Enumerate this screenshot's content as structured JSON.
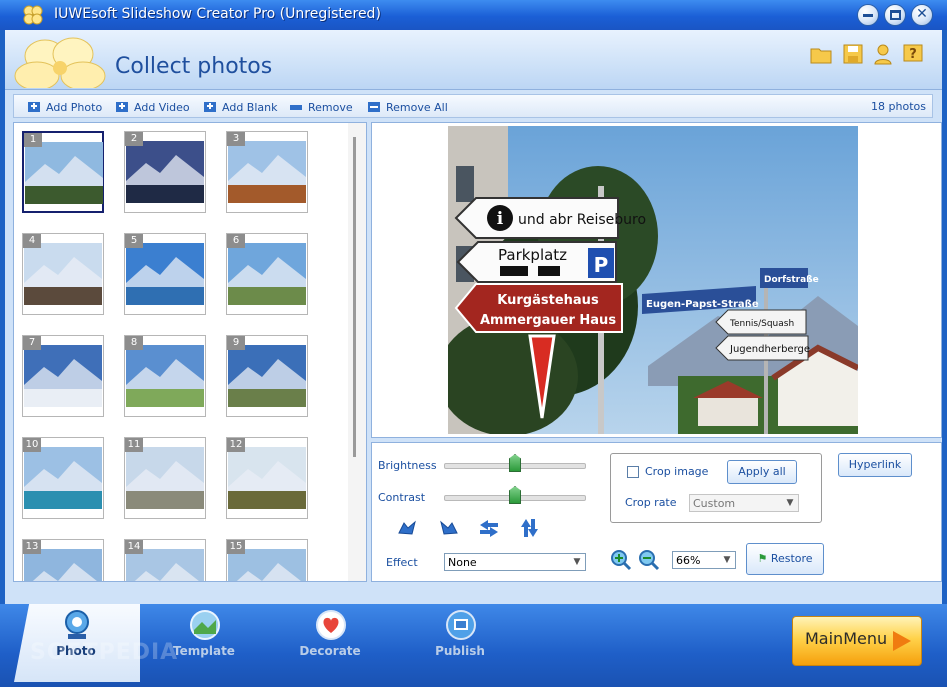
{
  "window": {
    "title": "IUWEsoft Slideshow Creator Pro (Unregistered)"
  },
  "header": {
    "title": "Collect photos"
  },
  "toolbar": {
    "add_photo": "Add Photo",
    "add_video": "Add Video",
    "add_blank": "Add Blank",
    "remove": "Remove",
    "remove_all": "Remove All",
    "photo_count": "18 photos"
  },
  "thumbnails": [
    {
      "num": "1",
      "sky": "#8fb9e0",
      "ground": "#3c5a2e"
    },
    {
      "num": "2",
      "sky": "#3c4f8a",
      "ground": "#1f2a45"
    },
    {
      "num": "3",
      "sky": "#9fc2e6",
      "ground": "#a35a2b"
    },
    {
      "num": "4",
      "sky": "#c9dbee",
      "ground": "#5b4a3c"
    },
    {
      "num": "5",
      "sky": "#3b7fd0",
      "ground": "#2f6fb2"
    },
    {
      "num": "6",
      "sky": "#6fa6dc",
      "ground": "#6c8b4a"
    },
    {
      "num": "7",
      "sky": "#3f6fb8",
      "ground": "#e9eef5"
    },
    {
      "num": "8",
      "sky": "#5a8fd0",
      "ground": "#7fa95a"
    },
    {
      "num": "9",
      "sky": "#3b6fb8",
      "ground": "#6a7f4a"
    },
    {
      "num": "10",
      "sky": "#9cc0e4",
      "ground": "#2b8fb0"
    },
    {
      "num": "11",
      "sky": "#c7d8ea",
      "ground": "#8a8a7a"
    },
    {
      "num": "12",
      "sky": "#d8e4ee",
      "ground": "#6a6a3a"
    },
    {
      "num": "13",
      "sky": "#8fb6de",
      "ground": "#4a6a3a"
    },
    {
      "num": "14",
      "sky": "#a9c6e4",
      "ground": "#6a5a4a"
    },
    {
      "num": "15",
      "sky": "#9dc0e2",
      "ground": "#7a6a5a"
    }
  ],
  "preview": {
    "sign1": "und abr Reiseburo",
    "sign2": "Parkplatz",
    "sign3a": "Kurgästehaus",
    "sign3b": "Ammergauer Haus",
    "sign4": "Eugen-Papst-Straße",
    "sign5": "Dorfstraße",
    "sign6": "Tennis/Squash",
    "sign7": "Jugendherberge",
    "parking_letter": "P",
    "info_letter": "i"
  },
  "controls": {
    "brightness_label": "Brightness",
    "contrast_label": "Contrast",
    "brightness_value": 0.5,
    "contrast_value": 0.5,
    "effect_label": "Effect",
    "effect_value": "None",
    "crop_image_label": "Crop image",
    "apply_all_label": "Apply all",
    "crop_rate_label": "Crop rate",
    "crop_rate_value": "Custom",
    "hyperlink_label": "Hyperlink",
    "zoom_value": "66%",
    "restore_label": "Restore"
  },
  "tabs": {
    "photo": "Photo",
    "template": "Template",
    "decorate": "Decorate",
    "publish": "Publish"
  },
  "main_menu_label": "MainMenu",
  "watermark": "SOFTPEDIA"
}
